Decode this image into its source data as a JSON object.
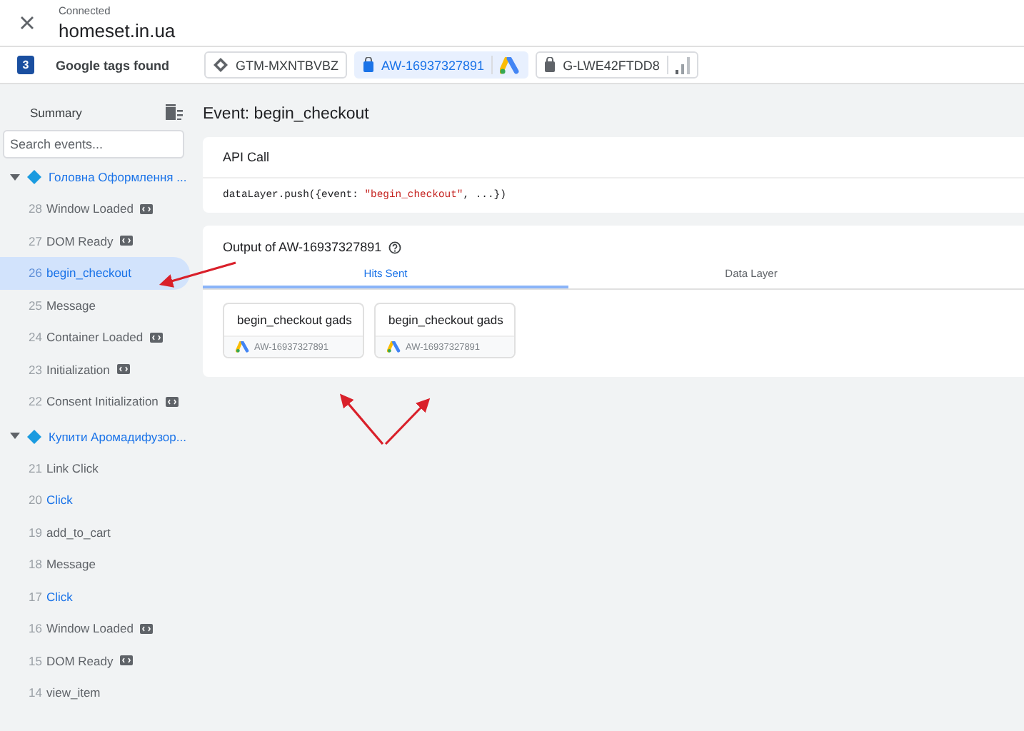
{
  "header": {
    "status": "Connected",
    "domain": "homeset.in.ua"
  },
  "tags_bar": {
    "count": "3",
    "label": "Google tags found",
    "tags": [
      {
        "id": "GTM-MXNTBVBZ",
        "kind": "container",
        "selected": false
      },
      {
        "id": "AW-16937327891",
        "kind": "ads",
        "selected": true
      },
      {
        "id": "G-LWE42FTDD8",
        "kind": "analytics",
        "selected": false
      }
    ]
  },
  "sidebar": {
    "summary": "Summary",
    "search": {
      "placeholder": "Search events..."
    },
    "groups": [
      {
        "title": "Головна Оформлення ...",
        "expanded": true,
        "children": [
          {
            "number": "28",
            "label": "Window Loaded",
            "badge": true,
            "tags_fired": false,
            "selected": false
          },
          {
            "number": "27",
            "label": "DOM Ready",
            "badge": true,
            "tags_fired": false,
            "selected": false
          },
          {
            "number": "26",
            "label": "begin_checkout",
            "badge": false,
            "tags_fired": true,
            "selected": true
          },
          {
            "number": "25",
            "label": "Message",
            "badge": false,
            "tags_fired": false,
            "selected": false
          },
          {
            "number": "24",
            "label": "Container Loaded",
            "badge": true,
            "tags_fired": false,
            "selected": false
          },
          {
            "number": "23",
            "label": "Initialization",
            "badge": true,
            "tags_fired": false,
            "selected": false
          },
          {
            "number": "22",
            "label": "Consent Initialization",
            "badge": true,
            "tags_fired": false,
            "selected": false
          }
        ]
      },
      {
        "title": "Купити Аромадифузор...",
        "expanded": true,
        "children": [
          {
            "number": "21",
            "label": "Link Click",
            "badge": false,
            "tags_fired": false,
            "selected": false
          },
          {
            "number": "20",
            "label": "Click",
            "badge": false,
            "tags_fired": true,
            "selected": false
          },
          {
            "number": "19",
            "label": "add_to_cart",
            "badge": false,
            "tags_fired": false,
            "selected": false
          },
          {
            "number": "18",
            "label": "Message",
            "badge": false,
            "tags_fired": false,
            "selected": false
          },
          {
            "number": "17",
            "label": "Click",
            "badge": false,
            "tags_fired": true,
            "selected": false
          },
          {
            "number": "16",
            "label": "Window Loaded",
            "badge": true,
            "tags_fired": false,
            "selected": false
          },
          {
            "number": "15",
            "label": "DOM Ready",
            "badge": true,
            "tags_fired": false,
            "selected": false
          },
          {
            "number": "14",
            "label": "view_item",
            "badge": false,
            "tags_fired": false,
            "selected": false
          }
        ]
      }
    ]
  },
  "event": {
    "title": "Event: begin_checkout",
    "api_call": {
      "title": "API Call",
      "code_prefix": "dataLayer.push({event: ",
      "code_string": "\"begin_checkout\"",
      "code_suffix": ", ...})"
    },
    "output": {
      "title": "Output of AW-16937327891",
      "tabs": [
        {
          "label": "Hits Sent",
          "selected": true
        },
        {
          "label": "Data Layer",
          "selected": false
        }
      ],
      "hits": [
        {
          "name": "begin_checkout gads",
          "tag_id": "AW-16937327891"
        },
        {
          "name": "begin_checkout gads",
          "tag_id": "AW-16937327891"
        }
      ]
    }
  }
}
